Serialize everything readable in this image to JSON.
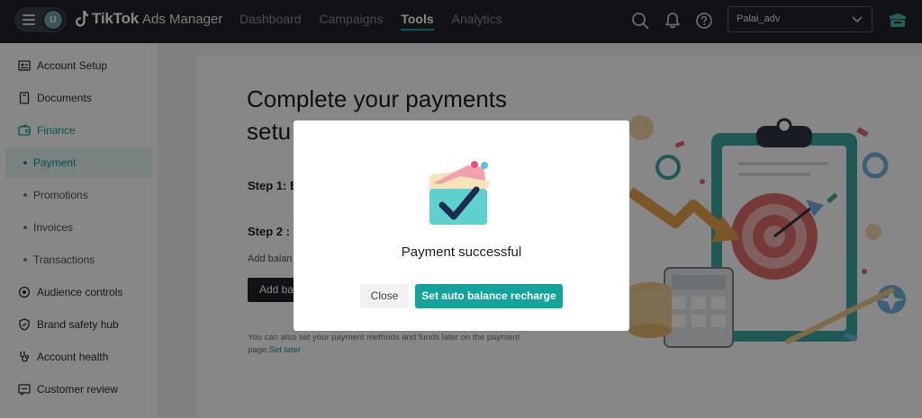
{
  "header": {
    "avatar_initial": "U",
    "brand_name": "TikTok",
    "brand_sub": "Ads Manager",
    "nav": [
      {
        "label": "Dashboard",
        "active": false
      },
      {
        "label": "Campaigns",
        "active": false
      },
      {
        "label": "Tools",
        "active": true
      },
      {
        "label": "Analytics",
        "active": false
      }
    ],
    "account": "Palai_adv"
  },
  "sidebar": {
    "items": [
      {
        "label": "Account Setup",
        "icon": "account-setup-icon"
      },
      {
        "label": "Documents",
        "icon": "document-icon"
      },
      {
        "label": "Finance",
        "icon": "wallet-icon"
      },
      {
        "label": "Payment"
      },
      {
        "label": "Promotions"
      },
      {
        "label": "Invoices"
      },
      {
        "label": "Transactions"
      },
      {
        "label": "Audience controls",
        "icon": "audience-icon"
      },
      {
        "label": "Brand safety hub",
        "icon": "shield-icon"
      },
      {
        "label": "Account health",
        "icon": "stethoscope-icon"
      },
      {
        "label": "Customer review",
        "icon": "review-icon"
      }
    ]
  },
  "main": {
    "heading": "Complete your payments setu",
    "step1": "Step 1: E",
    "step2": "Step 2 :",
    "add_text": "Add balan",
    "add_button": "Add ba",
    "later_text": "You can also set your payment methods and funds later on the payment page.",
    "later_link": "Set later"
  },
  "modal": {
    "title": "Payment successful",
    "close_label": "Close",
    "primary_label": "Set auto balance recharge"
  },
  "colors": {
    "accent": "#12a39c",
    "topbar": "#1f2328",
    "sidebar_active_bg": "#e7f5f4"
  }
}
